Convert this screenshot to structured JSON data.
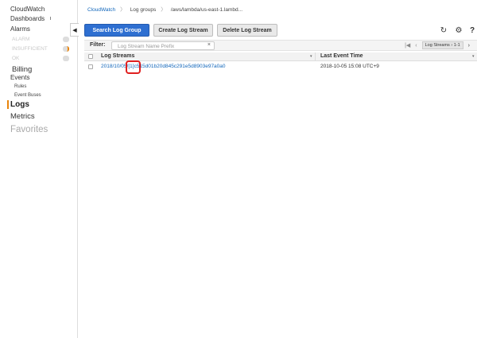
{
  "sidebar": {
    "cloudwatch": "CloudWatch",
    "dashboards": "Dashboards",
    "alarms": "Alarms",
    "alarm": "ALARM",
    "insufficient": "INSUFFICIENT",
    "ok": "OK",
    "billing": "Billing",
    "events": "Events",
    "rules": "Rules",
    "event_buses": "Event Buses",
    "logs": "Logs",
    "metrics": "Metrics",
    "favorites": "Favorites",
    "collapse_glyph": "◀"
  },
  "breadcrumb": {
    "root": "CloudWatch",
    "sep1": "〉",
    "log_groups": "Log groups",
    "sep2": "〉",
    "current": "/aws/lambda/us-east-1.lambd..."
  },
  "toolbar": {
    "search_log_group": "Search Log Group",
    "create_log_stream": "Create Log Stream",
    "delete_log_stream": "Delete Log Stream",
    "refresh_glyph": "↻",
    "settings_glyph": "⚙",
    "help_glyph": "?"
  },
  "filter": {
    "label": "Filter:",
    "placeholder": "Log Stream Name Prefix",
    "clear_glyph": "×"
  },
  "pager": {
    "first_glyph": "|◀",
    "prev_glyph": "‹",
    "range": "Log Streams › 1-1",
    "next_glyph": "›"
  },
  "table": {
    "columns": [
      "Log Streams",
      "Last Event Time"
    ],
    "sort_glyph": "▾",
    "rows": [
      {
        "stream": "2018/10/05/[1]c515d01b20d845c291e5d8903e97a0a0",
        "last_event": "2018-10-05 15:08 UTC+9"
      }
    ]
  },
  "colors": {
    "primary": "#2e6fd1",
    "link": "#1166bb",
    "accent": "#e8840b",
    "highlight": "#e02020"
  }
}
